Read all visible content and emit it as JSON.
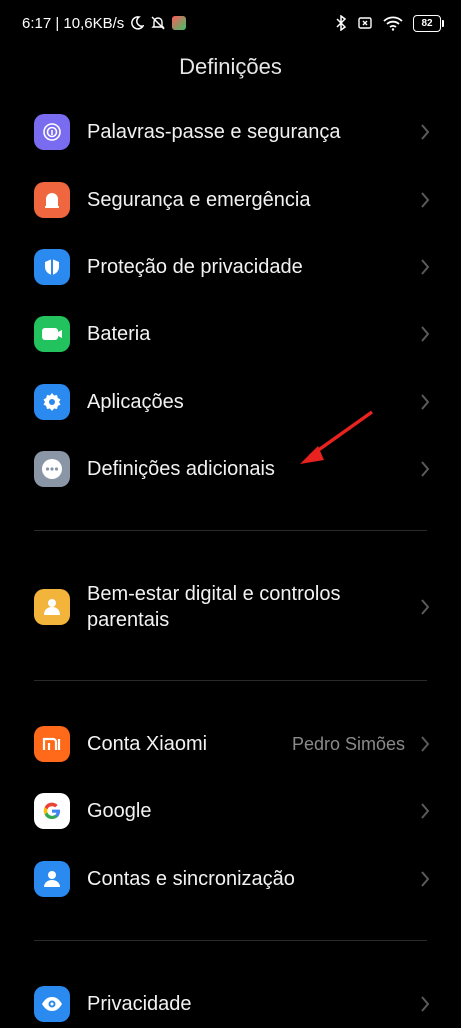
{
  "status_bar": {
    "time_speed": "6:17 | 10,6KB/s",
    "battery": "82"
  },
  "header": {
    "title": "Definições"
  },
  "items": [
    {
      "label": "Palavras-passe e segurança",
      "icon": "fingerprint-icon",
      "color": "#7a6cf0"
    },
    {
      "label": "Segurança e emergência",
      "icon": "emergency-icon",
      "color": "#f0663e"
    },
    {
      "label": "Proteção de privacidade",
      "icon": "shield-icon",
      "color": "#2b8af0"
    },
    {
      "label": "Bateria",
      "icon": "battery-icon",
      "color": "#22c25e"
    },
    {
      "label": "Aplicações",
      "icon": "gear-icon",
      "color": "#2b8af0"
    },
    {
      "label": "Definições adicionais",
      "icon": "more-icon",
      "color": "#8a96a6"
    },
    {
      "label": "Bem-estar digital e controlos parentais",
      "icon": "wellbeing-icon",
      "color": "#f3b43b"
    },
    {
      "label": "Conta Xiaomi",
      "value": "Pedro Simões",
      "icon": "xiaomi-icon",
      "color": "#ff6a1a"
    },
    {
      "label": "Google",
      "icon": "google-icon",
      "color": "#ffffff"
    },
    {
      "label": "Contas e sincronização",
      "icon": "account-icon",
      "color": "#2b8af0"
    },
    {
      "label": "Privacidade",
      "icon": "eye-icon",
      "color": "#2b8af0"
    }
  ]
}
